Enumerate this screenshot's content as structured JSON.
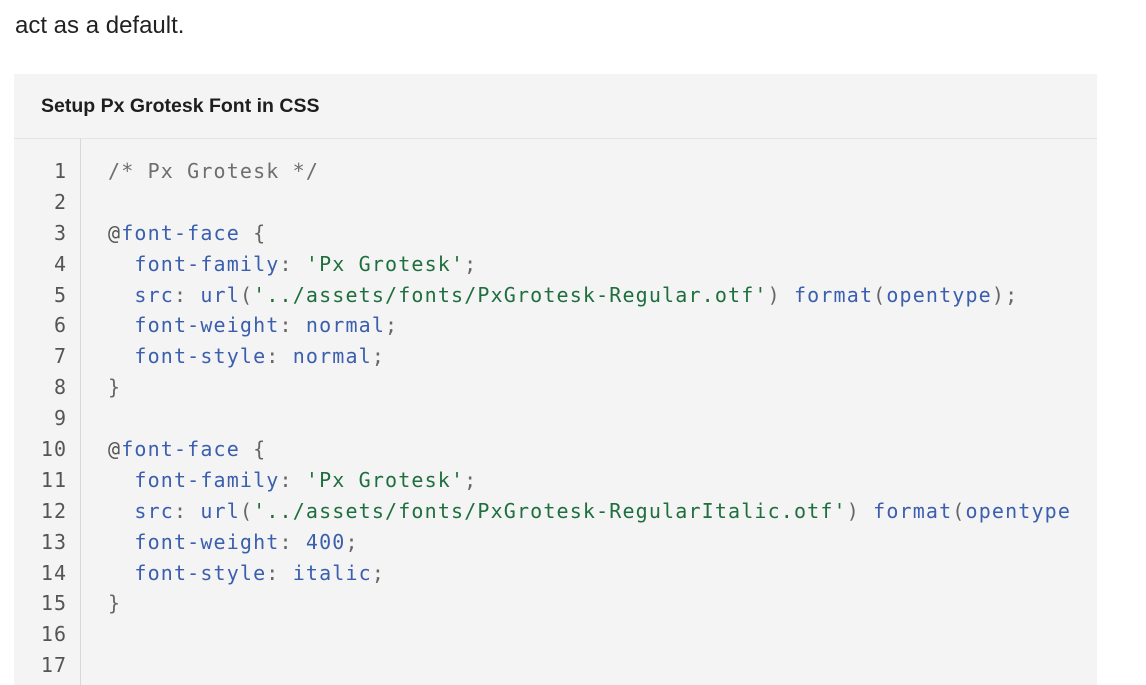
{
  "intro_text": "act as a default.",
  "code_block": {
    "title": "Setup Px Grotesk Font in CSS",
    "lines": [
      {
        "n": "1",
        "tokens": [
          {
            "t": "/* Px Grotesk */",
            "c": "c-comment"
          }
        ]
      },
      {
        "n": "2",
        "tokens": []
      },
      {
        "n": "3",
        "tokens": [
          {
            "t": "@",
            "c": "c-at"
          },
          {
            "t": "font-face",
            "c": "c-kw"
          },
          {
            "t": " {",
            "c": "c-punc"
          }
        ]
      },
      {
        "n": "4",
        "tokens": [
          {
            "t": "  font-family",
            "c": "c-prop"
          },
          {
            "t": ": ",
            "c": "c-punc"
          },
          {
            "t": "'Px Grotesk'",
            "c": "c-str"
          },
          {
            "t": ";",
            "c": "c-punc"
          }
        ]
      },
      {
        "n": "5",
        "tokens": [
          {
            "t": "  src",
            "c": "c-prop"
          },
          {
            "t": ": ",
            "c": "c-punc"
          },
          {
            "t": "url",
            "c": "c-val"
          },
          {
            "t": "(",
            "c": "c-punc"
          },
          {
            "t": "'../assets/fonts/PxGrotesk-Regular.otf'",
            "c": "c-str"
          },
          {
            "t": ") ",
            "c": "c-punc"
          },
          {
            "t": "format",
            "c": "c-val"
          },
          {
            "t": "(",
            "c": "c-punc"
          },
          {
            "t": "opentype",
            "c": "c-val"
          },
          {
            "t": ");",
            "c": "c-punc"
          }
        ]
      },
      {
        "n": "6",
        "tokens": [
          {
            "t": "  font-weight",
            "c": "c-prop"
          },
          {
            "t": ": ",
            "c": "c-punc"
          },
          {
            "t": "normal",
            "c": "c-val"
          },
          {
            "t": ";",
            "c": "c-punc"
          }
        ]
      },
      {
        "n": "7",
        "tokens": [
          {
            "t": "  font-style",
            "c": "c-prop"
          },
          {
            "t": ": ",
            "c": "c-punc"
          },
          {
            "t": "normal",
            "c": "c-val"
          },
          {
            "t": ";",
            "c": "c-punc"
          }
        ]
      },
      {
        "n": "8",
        "tokens": [
          {
            "t": "}",
            "c": "c-punc"
          }
        ]
      },
      {
        "n": "9",
        "tokens": []
      },
      {
        "n": "10",
        "tokens": [
          {
            "t": "@",
            "c": "c-at"
          },
          {
            "t": "font-face",
            "c": "c-kw"
          },
          {
            "t": " {",
            "c": "c-punc"
          }
        ]
      },
      {
        "n": "11",
        "tokens": [
          {
            "t": "  font-family",
            "c": "c-prop"
          },
          {
            "t": ": ",
            "c": "c-punc"
          },
          {
            "t": "'Px Grotesk'",
            "c": "c-str"
          },
          {
            "t": ";",
            "c": "c-punc"
          }
        ]
      },
      {
        "n": "12",
        "tokens": [
          {
            "t": "  src",
            "c": "c-prop"
          },
          {
            "t": ": ",
            "c": "c-punc"
          },
          {
            "t": "url",
            "c": "c-val"
          },
          {
            "t": "(",
            "c": "c-punc"
          },
          {
            "t": "'../assets/fonts/PxGrotesk-RegularItalic.otf'",
            "c": "c-str"
          },
          {
            "t": ") ",
            "c": "c-punc"
          },
          {
            "t": "format",
            "c": "c-val"
          },
          {
            "t": "(",
            "c": "c-punc"
          },
          {
            "t": "opentype",
            "c": "c-val"
          }
        ]
      },
      {
        "n": "13",
        "tokens": [
          {
            "t": "  font-weight",
            "c": "c-prop"
          },
          {
            "t": ": ",
            "c": "c-punc"
          },
          {
            "t": "400",
            "c": "c-val"
          },
          {
            "t": ";",
            "c": "c-punc"
          }
        ]
      },
      {
        "n": "14",
        "tokens": [
          {
            "t": "  font-style",
            "c": "c-prop"
          },
          {
            "t": ": ",
            "c": "c-punc"
          },
          {
            "t": "italic",
            "c": "c-val"
          },
          {
            "t": ";",
            "c": "c-punc"
          }
        ]
      },
      {
        "n": "15",
        "tokens": [
          {
            "t": "}",
            "c": "c-punc"
          }
        ]
      },
      {
        "n": "16",
        "tokens": []
      },
      {
        "n": "17",
        "tokens": []
      }
    ]
  }
}
